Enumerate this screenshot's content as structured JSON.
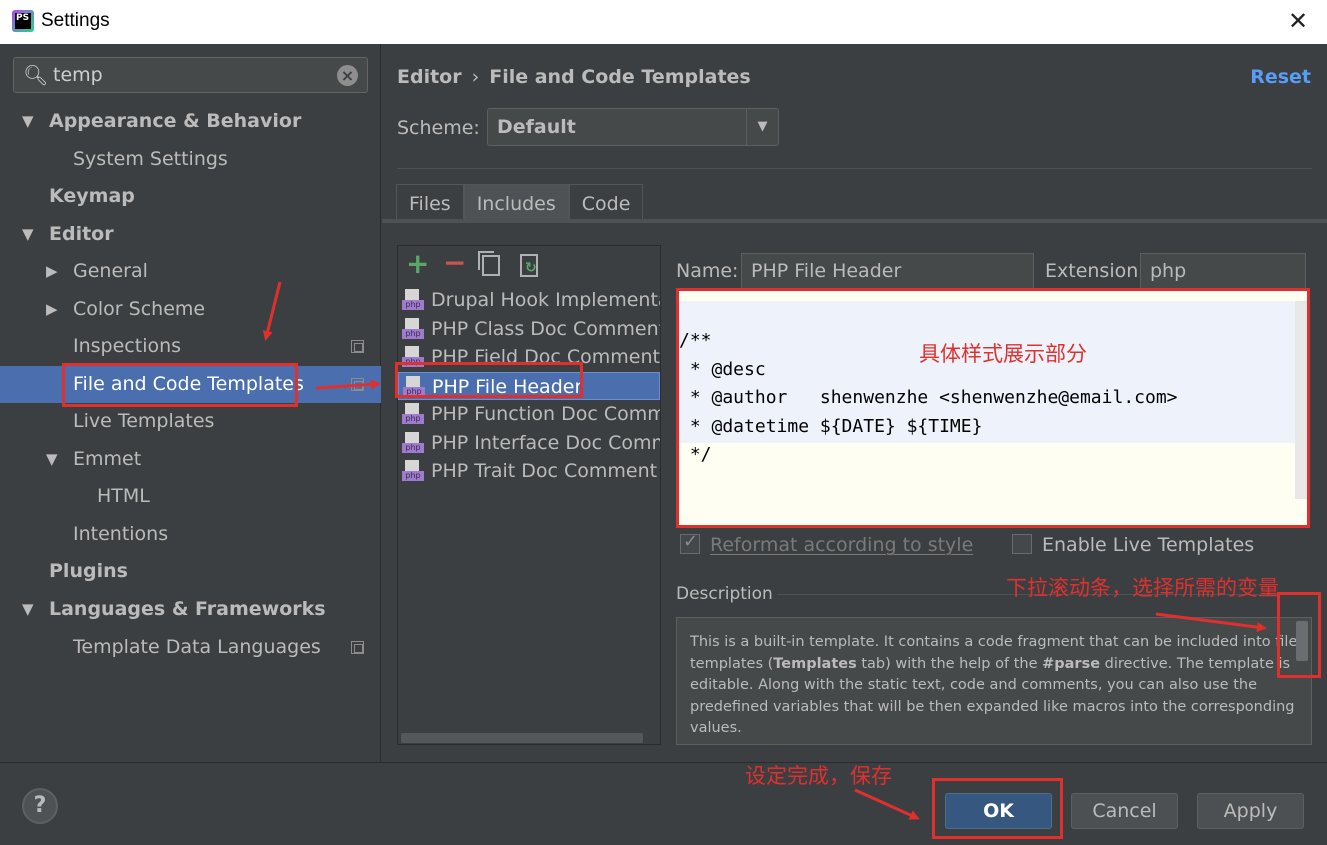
{
  "window": {
    "title": "Settings",
    "app_icon": "phpstorm-logo-icon",
    "logo_text": "PS"
  },
  "search": {
    "value": "temp"
  },
  "tree": [
    {
      "label": "Appearance & Behavior",
      "bold": true,
      "expanded": true
    },
    {
      "label": "System Settings"
    },
    {
      "label": "Keymap",
      "bold": true
    },
    {
      "label": "Editor",
      "bold": true,
      "expanded": true
    },
    {
      "label": "General",
      "expandable": true
    },
    {
      "label": "Color Scheme",
      "expandable": true
    },
    {
      "label": "Inspections"
    },
    {
      "label": "File and Code Templates",
      "selected": true
    },
    {
      "label": "Live Templates"
    },
    {
      "label": "Emmet",
      "expanded": true
    },
    {
      "label": "HTML"
    },
    {
      "label": "Intentions"
    },
    {
      "label": "Plugins",
      "bold": true
    },
    {
      "label": "Languages & Frameworks",
      "bold": true,
      "expanded": true
    },
    {
      "label": "Template Data Languages"
    }
  ],
  "header": {
    "crumb1": "Editor",
    "crumb2": "File and Code Templates",
    "reset": "Reset"
  },
  "scheme": {
    "label": "Scheme:",
    "value": "Default"
  },
  "tabs": [
    "Files",
    "Includes",
    "Code"
  ],
  "active_tab": "Includes",
  "templates": [
    "Drupal Hook Implementation",
    "PHP Class Doc Comment",
    "PHP Field Doc Comment",
    "PHP File Header",
    "PHP Function Doc Comment",
    "PHP Interface Doc Comment",
    "PHP Trait Doc Comment"
  ],
  "selected_template": "PHP File Header",
  "icon_tag": "php",
  "form": {
    "name_label": "Name:",
    "name_value": "PHP File Header",
    "ext_label": "Extension:",
    "ext_value": "php"
  },
  "code_lines": [
    "/**",
    " * @desc",
    " * @author   shenwenzhe <shenwenzhe@email.com>",
    " * @datetime ${DATE} ${TIME}",
    " */"
  ],
  "options": {
    "reformat": "Reformat according to style",
    "live_templates": "Enable Live Templates"
  },
  "description": {
    "label": "Description",
    "text_before": "This is a built-in template. It contains a code fragment that can be included into file templates (",
    "bold1": "Templates",
    "text_mid": " tab) with the help of the ",
    "bold2": "#parse",
    "text_after": " directive. The template is editable. Along with the static text, code and comments, you can also use the predefined variables that will be then expanded like macros into the corresponding values."
  },
  "buttons": {
    "ok": "OK",
    "cancel": "Cancel",
    "apply": "Apply",
    "help": "?"
  },
  "annotations": {
    "editor_note": "具体样式展示部分",
    "scroll_note": "下拉滚动条，选择所需的变量",
    "save_note": "设定完成，保存"
  },
  "colors": {
    "selection": "#4b6eaf",
    "annotation": "#e0302e",
    "link": "#589df6"
  }
}
